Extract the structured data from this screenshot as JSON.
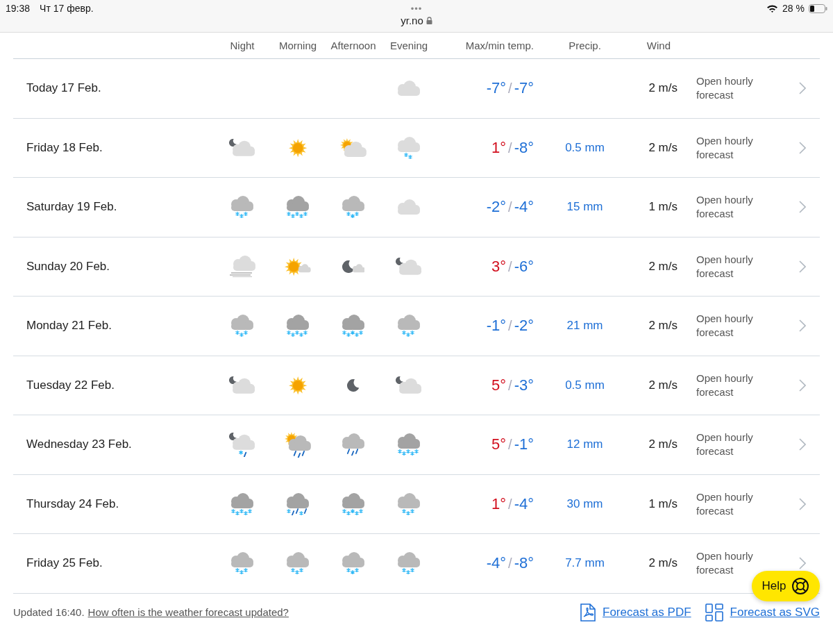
{
  "status_bar": {
    "time": "19:38",
    "date": "Чт 17 февр.",
    "dots": "•••",
    "address": "yr.no",
    "battery": "28 %"
  },
  "table": {
    "columns": [
      "Night",
      "Morning",
      "Afternoon",
      "Evening",
      "Max/min temp.",
      "Precip.",
      "Wind"
    ],
    "rows": [
      {
        "day": "Today 17 Feb.",
        "icons": {
          "evening": {
            "kind": "cloud"
          }
        },
        "max": {
          "text": "-7°",
          "color": "#1e6fd6"
        },
        "separator": "/",
        "min": {
          "text": "-7°",
          "color": "#1e6fd6"
        },
        "wind": "2 m/s",
        "link": "Open hourly forecast"
      },
      {
        "day": "Friday 18 Feb.",
        "icons": {
          "night": {
            "kind": "moon-cloud"
          },
          "morning": {
            "kind": "sun"
          },
          "afternoon": {
            "kind": "sun-cloud"
          },
          "evening": {
            "kind": "light-snow"
          }
        },
        "max": {
          "text": "1°",
          "color": "#d20f1e"
        },
        "separator": "/",
        "min": {
          "text": "-8°",
          "color": "#1e6fd6"
        },
        "precip": "0.5 mm",
        "wind": "2 m/s",
        "link": "Open hourly forecast"
      },
      {
        "day": "Saturday 19 Feb.",
        "icons": {
          "night": {
            "kind": "snow"
          },
          "morning": {
            "kind": "heavy-snow"
          },
          "afternoon": {
            "kind": "snow"
          },
          "evening": {
            "kind": "cloud"
          }
        },
        "max": {
          "text": "-2°",
          "color": "#1e6fd6"
        },
        "separator": "/",
        "min": {
          "text": "-4°",
          "color": "#1e6fd6"
        },
        "precip": "15 mm",
        "wind": "1 m/s",
        "link": "Open hourly forecast"
      },
      {
        "day": "Sunday 20 Feb.",
        "icons": {
          "night": {
            "kind": "fog"
          },
          "morning": {
            "kind": "sun-small-cloud"
          },
          "afternoon": {
            "kind": "moon-small-cloud"
          },
          "evening": {
            "kind": "moon-cloud"
          }
        },
        "max": {
          "text": "3°",
          "color": "#d20f1e"
        },
        "separator": "/",
        "min": {
          "text": "-6°",
          "color": "#1e6fd6"
        },
        "wind": "2 m/s",
        "link": "Open hourly forecast"
      },
      {
        "day": "Monday 21 Feb.",
        "icons": {
          "night": {
            "kind": "snow"
          },
          "morning": {
            "kind": "heavy-snow"
          },
          "afternoon": {
            "kind": "heavy-snow"
          },
          "evening": {
            "kind": "snow"
          }
        },
        "max": {
          "text": "-1°",
          "color": "#1e6fd6"
        },
        "separator": "/",
        "min": {
          "text": "-2°",
          "color": "#1e6fd6"
        },
        "precip": "21 mm",
        "wind": "2 m/s",
        "link": "Open hourly forecast"
      },
      {
        "day": "Tuesday 22 Feb.",
        "icons": {
          "night": {
            "kind": "moon-cloud"
          },
          "morning": {
            "kind": "sun"
          },
          "afternoon": {
            "kind": "moon"
          },
          "evening": {
            "kind": "moon-cloud"
          }
        },
        "max": {
          "text": "5°",
          "color": "#d20f1e"
        },
        "separator": "/",
        "min": {
          "text": "-3°",
          "color": "#1e6fd6"
        },
        "precip": "0.5 mm",
        "wind": "2 m/s",
        "link": "Open hourly forecast"
      },
      {
        "day": "Wednesday 23 Feb.",
        "icons": {
          "night": {
            "kind": "moon-sleet"
          },
          "morning": {
            "kind": "sun-rain"
          },
          "afternoon": {
            "kind": "rain"
          },
          "evening": {
            "kind": "heavy-snow"
          }
        },
        "max": {
          "text": "5°",
          "color": "#d20f1e"
        },
        "separator": "/",
        "min": {
          "text": "-1°",
          "color": "#1e6fd6"
        },
        "precip": "12 mm",
        "wind": "2 m/s",
        "link": "Open hourly forecast"
      },
      {
        "day": "Thursday 24 Feb.",
        "icons": {
          "night": {
            "kind": "heavy-snow"
          },
          "morning": {
            "kind": "sleet"
          },
          "afternoon": {
            "kind": "heavy-snow"
          },
          "evening": {
            "kind": "snow"
          }
        },
        "max": {
          "text": "1°",
          "color": "#d20f1e"
        },
        "separator": "/",
        "min": {
          "text": "-4°",
          "color": "#1e6fd6"
        },
        "precip": "30 mm",
        "wind": "1 m/s",
        "link": "Open hourly forecast"
      },
      {
        "day": "Friday 25 Feb.",
        "icons": {
          "night": {
            "kind": "snow"
          },
          "morning": {
            "kind": "snow"
          },
          "afternoon": {
            "kind": "snow"
          },
          "evening": {
            "kind": "snow"
          }
        },
        "max": {
          "text": "-4°",
          "color": "#1e6fd6"
        },
        "separator": "/",
        "min": {
          "text": "-8°",
          "color": "#1e6fd6"
        },
        "precip": "7.7 mm",
        "wind": "2 m/s",
        "link": "Open hourly forecast"
      }
    ]
  },
  "footer": {
    "updated": "Updated 16:40.",
    "faq_link": "How often is the weather forecast updated?",
    "pdf_link": "Forecast as PDF",
    "svg_link": "Forecast as SVG"
  },
  "help_button": "Help"
}
